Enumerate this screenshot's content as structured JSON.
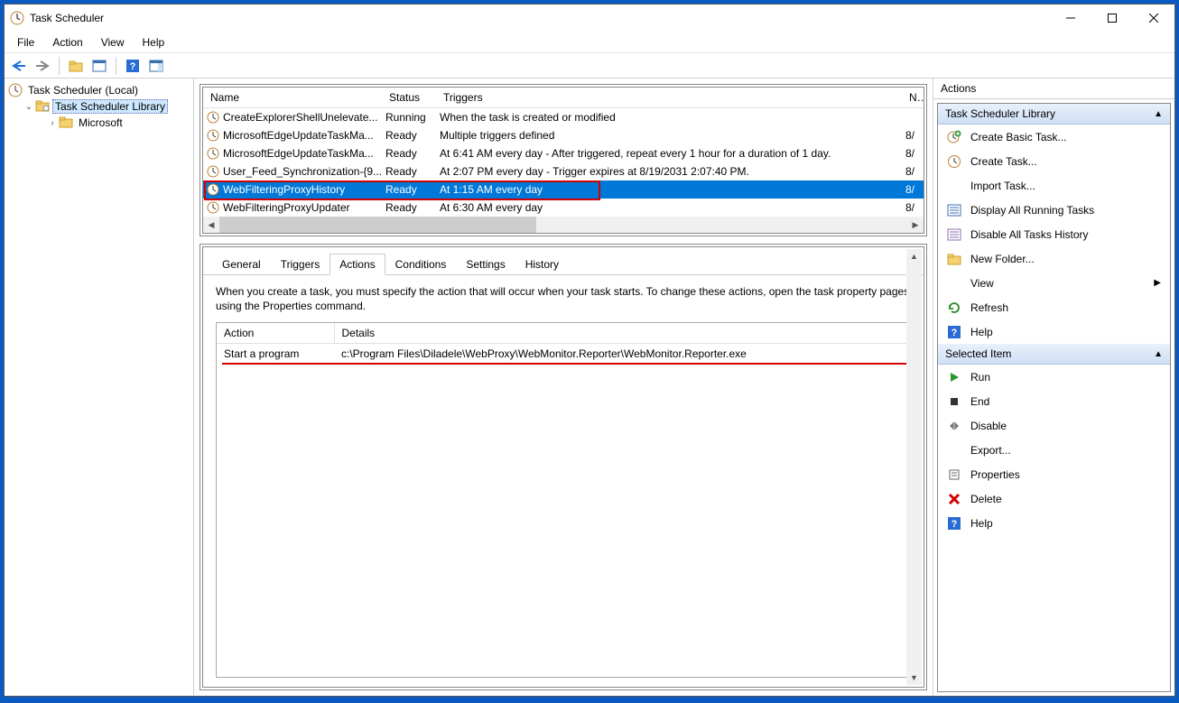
{
  "window": {
    "title": "Task Scheduler"
  },
  "menu": {
    "file": "File",
    "action": "Action",
    "view": "View",
    "help": "Help"
  },
  "tree": {
    "root": "Task Scheduler (Local)",
    "library": "Task Scheduler Library",
    "microsoft": "Microsoft"
  },
  "task_columns": {
    "name": "Name",
    "status": "Status",
    "triggers": "Triggers",
    "next": "N"
  },
  "tasks": [
    {
      "name": "CreateExplorerShellUnelevate...",
      "status": "Running",
      "triggers": "When the task is created or modified",
      "next": ""
    },
    {
      "name": "MicrosoftEdgeUpdateTaskMa...",
      "status": "Ready",
      "triggers": "Multiple triggers defined",
      "next": "8/"
    },
    {
      "name": "MicrosoftEdgeUpdateTaskMa...",
      "status": "Ready",
      "triggers": "At 6:41 AM every day - After triggered, repeat every 1 hour for a duration of 1 day.",
      "next": "8/"
    },
    {
      "name": "User_Feed_Synchronization-{9...",
      "status": "Ready",
      "triggers": "At 2:07 PM every day - Trigger expires at 8/19/2031 2:07:40 PM.",
      "next": "8/"
    },
    {
      "name": "WebFilteringProxyHistory",
      "status": "Ready",
      "triggers": "At 1:15 AM every day",
      "next": "8/",
      "selected": true
    },
    {
      "name": "WebFilteringProxyUpdater",
      "status": "Ready",
      "triggers": "At 6:30 AM every day",
      "next": "8/"
    }
  ],
  "tabs": {
    "general": "General",
    "triggers": "Triggers",
    "actions": "Actions",
    "conditions": "Conditions",
    "settings": "Settings",
    "history": "History"
  },
  "tab_desc": "When you create a task, you must specify the action that will occur when your task starts.  To change these actions, open the task property pages using the Properties command.",
  "actions_table": {
    "col_action": "Action",
    "col_details": "Details",
    "rows": [
      {
        "action": "Start a program",
        "details": "c:\\Program Files\\Diladele\\WebProxy\\WebMonitor.Reporter\\WebMonitor.Reporter.exe"
      }
    ]
  },
  "actions_pane": {
    "title": "Actions",
    "group1": {
      "header": "Task Scheduler Library",
      "items": [
        {
          "id": "create-basic-task",
          "label": "Create Basic Task...",
          "icon": "clock-add"
        },
        {
          "id": "create-task",
          "label": "Create Task...",
          "icon": "clock"
        },
        {
          "id": "import-task",
          "label": "Import Task...",
          "icon": "none"
        },
        {
          "id": "display-running",
          "label": "Display All Running Tasks",
          "icon": "list"
        },
        {
          "id": "disable-history",
          "label": "Disable All Tasks History",
          "icon": "list2"
        },
        {
          "id": "new-folder",
          "label": "New Folder...",
          "icon": "folder"
        },
        {
          "id": "view",
          "label": "View",
          "icon": "none",
          "arrow": true
        },
        {
          "id": "refresh",
          "label": "Refresh",
          "icon": "refresh"
        },
        {
          "id": "help1",
          "label": "Help",
          "icon": "help"
        }
      ]
    },
    "group2": {
      "header": "Selected Item",
      "items": [
        {
          "id": "run",
          "label": "Run",
          "icon": "play"
        },
        {
          "id": "end",
          "label": "End",
          "icon": "stop"
        },
        {
          "id": "disable",
          "label": "Disable",
          "icon": "disable"
        },
        {
          "id": "export",
          "label": "Export...",
          "icon": "none"
        },
        {
          "id": "properties",
          "label": "Properties",
          "icon": "props"
        },
        {
          "id": "delete",
          "label": "Delete",
          "icon": "delete"
        },
        {
          "id": "help2",
          "label": "Help",
          "icon": "help"
        }
      ]
    }
  }
}
